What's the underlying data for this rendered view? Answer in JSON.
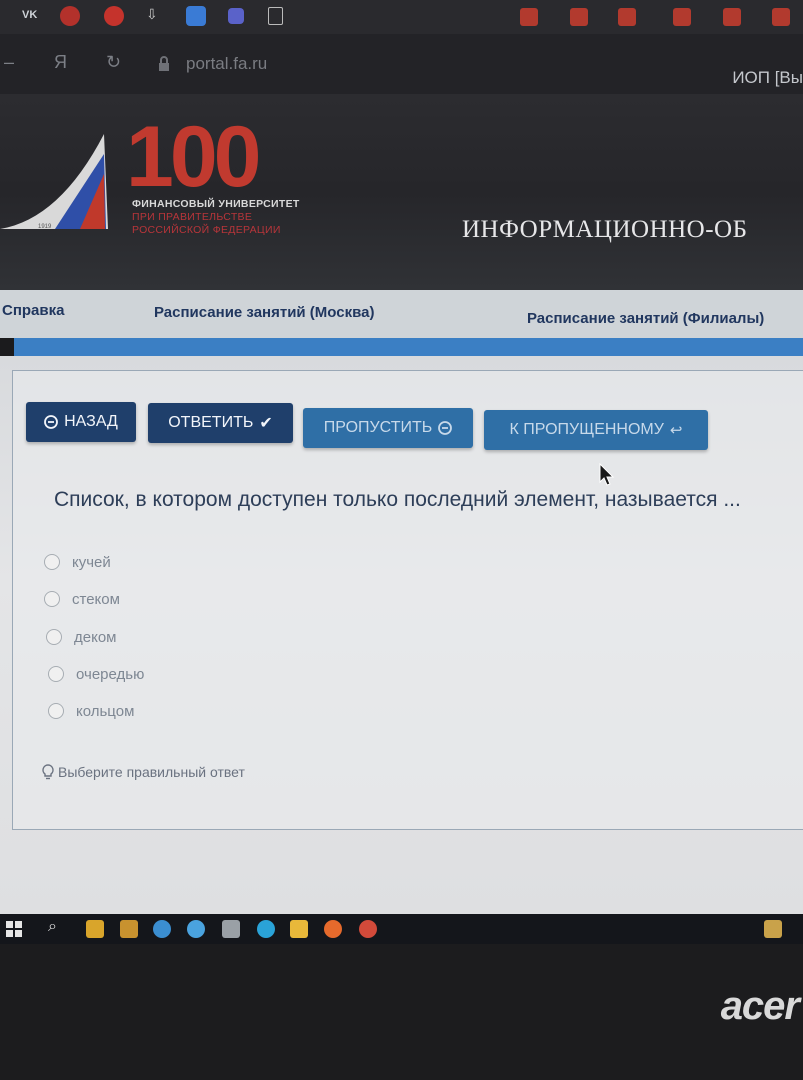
{
  "browser": {
    "bookmark_vk": "VK",
    "url": "portal.fa.ru",
    "tab_title": "ИОП [Вы"
  },
  "header": {
    "logo_number": "100",
    "logo_line1": "ФИНАНСОВЫЙ УНИВЕРСИТЕТ",
    "logo_line2": "ПРИ ПРАВИТЕЛЬСТВЕ",
    "logo_line3": "РОССИЙСКОЙ ФЕДЕРАЦИИ",
    "logo_year": "1919",
    "site_title": "ИНФОРМАЦИОННО-ОБ"
  },
  "nav": {
    "items": [
      {
        "label": "Справка"
      },
      {
        "label": "Расписание занятий (Москва)"
      },
      {
        "label": "Расписание занятий (Филиалы)"
      }
    ]
  },
  "toolbar": {
    "back": "НАЗАД",
    "answer": "ОТВЕТИТЬ",
    "skip": "ПРОПУСТИТЬ",
    "to_skipped": "К ПРОПУЩЕННОМУ"
  },
  "quiz": {
    "question": "Список, в котором доступен только последний элемент, называется ...",
    "options": [
      {
        "label": "кучей"
      },
      {
        "label": "стеком"
      },
      {
        "label": "деком"
      },
      {
        "label": "очередью"
      },
      {
        "label": "кольцом"
      }
    ],
    "hint": "Выберите правильный ответ"
  },
  "laptop": {
    "brand": "acer"
  },
  "colors": {
    "primary_button": "#1f3f6b",
    "secondary_button": "#2f6fa6",
    "logo_red": "#c13a2f",
    "nav_text": "#21375f",
    "accent_strip": "#3b7fc4"
  }
}
